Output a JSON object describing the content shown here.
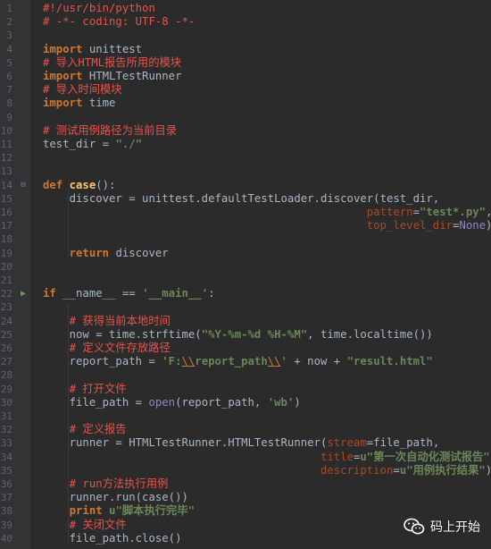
{
  "gutter": {
    "line_numbers": [
      "1",
      "2",
      "3",
      "4",
      "5",
      "6",
      "7",
      "8",
      "9",
      "10",
      "11",
      "12",
      "13",
      "14",
      "15",
      "16",
      "17",
      "18",
      "19",
      "20",
      "21",
      "22",
      "23",
      "24",
      "25",
      "26",
      "27",
      "28",
      "29",
      "30",
      "31",
      "32",
      "33",
      "34",
      "35",
      "36",
      "37",
      "38",
      "39",
      "40"
    ]
  },
  "code": {
    "l1": "#!/usr/bin/python",
    "l2": "# -*- coding: UTF-8 -*-",
    "l4_kw": "import",
    "l4_rest": " unittest",
    "l5": "# 导入HTML报告所用的模块",
    "l6_kw": "import",
    "l6_rest": " HTMLTestRunner",
    "l7": "# 导入时间模块",
    "l8_kw": "import",
    "l8_rest": " time",
    "l10": "# 测试用例路径为当前目录",
    "l11_a": "test_dir = ",
    "l11_str": "\"./\"",
    "l14_kw": "def",
    "l14_fn": "case",
    "l14_rest": "():",
    "l15_a": "    discover = unittest.defaultTestLoader.discover(test_dir,",
    "l16_pad": "                                                 ",
    "l16_param": "pattern",
    "l16_eq": "=",
    "l16_str": "\"test*.py\"",
    "l16_end": ",",
    "l17_pad": "                                                 ",
    "l17_param": "top_level_dir",
    "l17_eq": "=",
    "l17_none": "None",
    "l17_end": ")",
    "l19_pad": "    ",
    "l19_kw": "return",
    "l19_rest": " discover",
    "l22_kw": "if",
    "l22_a": " __name__ == ",
    "l22_str": "'__main__'",
    "l22_end": ":",
    "l24": "    # 获得当前本地时间",
    "l25_a": "    now = time.strftime(",
    "l25_str": "\"%Y-%m-%d %H-%M\"",
    "l25_b": ", time.localtime())",
    "l26": "    # 定义文件存放路径",
    "l27_a": "    report_path = ",
    "l27_s1": "'F:",
    "l27_e1": "\\\\",
    "l27_s2": "report_path",
    "l27_e2": "\\\\",
    "l27_s3": "'",
    "l27_b": " + now + ",
    "l27_s4": "\"result.html\"",
    "l29": "    # 打开文件",
    "l30_a": "    file_path = ",
    "l30_bi": "open",
    "l30_b": "(report_path, ",
    "l30_str": "'wb'",
    "l30_c": ")",
    "l32": "    # 定义报告",
    "l33_a": "    runner = HTMLTestRunner.HTMLTestRunner(",
    "l33_param": "stream",
    "l33_b": "=file_path,",
    "l34_pad": "                                          ",
    "l34_param": "title",
    "l34_eq": "=",
    "l34_str": "u\"第一次自动化测试报告\"",
    "l34_end": ",",
    "l35_pad": "                                          ",
    "l35_param": "description",
    "l35_eq": "=",
    "l35_str": "u\"用例执行结果\"",
    "l35_end": ")",
    "l37": "    # run方法执行用例",
    "l38": "    runner.run(case())",
    "l39_pad": "    ",
    "l39_kw": "print",
    "l39_str": " u\"脚本执行完毕\"",
    "l40_pad": "    ",
    "l40_cm": "# 关闭文件",
    "l41": "    file_path.close()"
  },
  "watermark": {
    "label": "码上开始",
    "icon": "wechat-icon"
  },
  "colors": {
    "background": "#2b2b2b",
    "keyword": "#cc7832",
    "comment": "#e8524c",
    "string": "#6a8759",
    "function": "#ffc66d",
    "param": "#aa4926",
    "builtin": "#8888c6"
  }
}
